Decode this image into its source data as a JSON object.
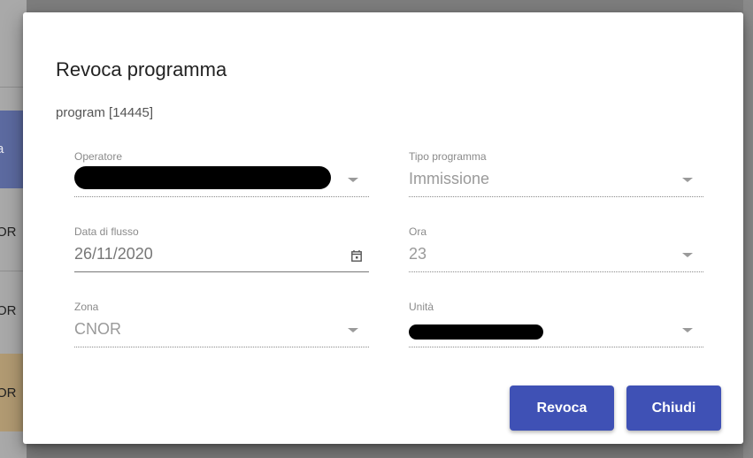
{
  "background": {
    "row_fragments": [
      "a",
      "OR",
      "OR",
      "OR"
    ]
  },
  "dialog": {
    "title": "Revoca programma",
    "subtitle": "program [14445]",
    "fields": {
      "operatore": {
        "label": "Operatore",
        "value": ""
      },
      "tipo_programma": {
        "label": "Tipo programma",
        "value": "Immissione"
      },
      "data_flusso": {
        "label": "Data di flusso",
        "value": "26/11/2020"
      },
      "ora": {
        "label": "Ora",
        "value": "23"
      },
      "zona": {
        "label": "Zona",
        "value": "CNOR"
      },
      "unita": {
        "label": "Unità",
        "value": ""
      }
    },
    "buttons": {
      "revoca": "Revoca",
      "chiudi": "Chiudi"
    }
  },
  "colors": {
    "primary": "#3f51b5",
    "overlay": "#7d7d7d"
  }
}
